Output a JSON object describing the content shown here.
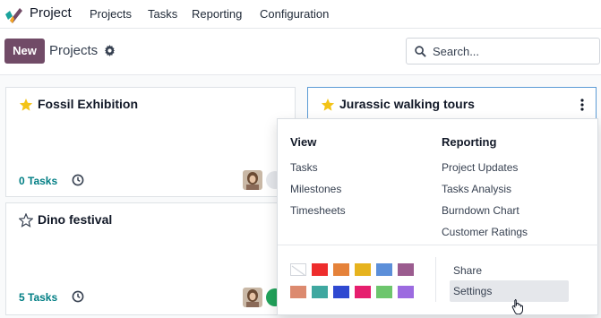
{
  "navbar": {
    "brand": "Project",
    "menu": [
      "Projects",
      "Tasks",
      "Reporting",
      "Configuration"
    ]
  },
  "control_panel": {
    "new_label": "New",
    "breadcrumb": "Projects",
    "search_placeholder": "Search..."
  },
  "cards": [
    {
      "title": "Fossil Exhibition",
      "favorite": true,
      "tasks": "0 Tasks",
      "status_color": "#e5e7eb"
    },
    {
      "title": "Jurassic walking tours",
      "favorite": true
    },
    {
      "title": "Dino festival",
      "favorite": false,
      "tasks": "5 Tasks",
      "status_color": "#21a35b"
    }
  ],
  "dropdown": {
    "view_header": "View",
    "view_items": [
      "Tasks",
      "Milestones",
      "Timesheets"
    ],
    "reporting_header": "Reporting",
    "reporting_items": [
      "Project Updates",
      "Tasks Analysis",
      "Burndown Chart",
      "Customer Ratings"
    ],
    "actions": [
      "Share",
      "Settings"
    ],
    "colors_row1": [
      "#ffffff",
      "#ee2d2d",
      "#e5823a",
      "#e6b31e",
      "#5c8fd9",
      "#9b5c8f"
    ],
    "colors_row2": [
      "#dc8a6f",
      "#3fa8a0",
      "#2f49d1",
      "#e61e6e",
      "#6dc66d",
      "#9c6be0"
    ]
  },
  "colors": {
    "brand": "#714b67",
    "link": "#017e84",
    "star": "#f3c316"
  }
}
